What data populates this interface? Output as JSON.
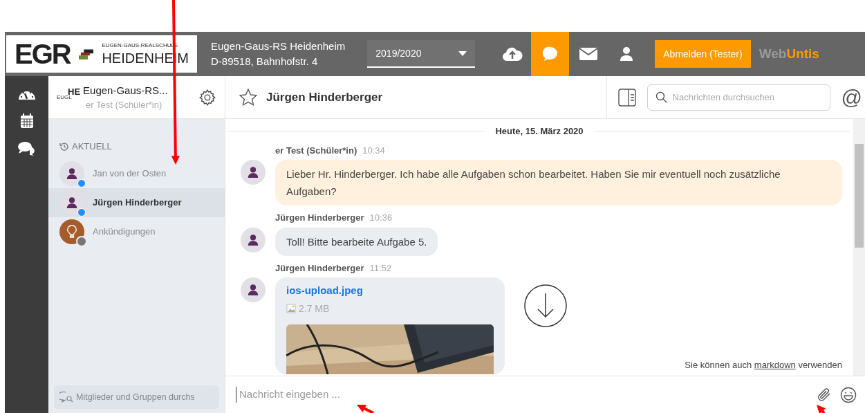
{
  "header": {
    "logo": {
      "letters": "EGR",
      "school_small": "EUGEN-GAUS-REALSCHULE",
      "school_big": "HEIDENHEIM"
    },
    "address": [
      "Eugen-Gaus-RS Heidenheim",
      "D-89518, Bahnhofstr. 4"
    ],
    "year": "2019/2020",
    "icons": [
      {
        "kind": "upload",
        "selected": false
      },
      {
        "kind": "chat",
        "selected": true
      },
      {
        "kind": "mail",
        "selected": false
      },
      {
        "kind": "user",
        "selected": false
      }
    ],
    "logout": "Abmelden (Tester)",
    "brand": [
      "Web",
      "Untis"
    ]
  },
  "rail": [
    {
      "kind": "dashboard"
    },
    {
      "kind": "calendar"
    },
    {
      "kind": "messages"
    }
  ],
  "sidebar": {
    "account": {
      "logo_small": "EUGL",
      "logo_big": "HE",
      "name": "Eugen-Gaus-RS...",
      "role": "er Test (Schüler*in)"
    },
    "section": "AKTUELL",
    "items": [
      {
        "name": "Jan von der Osten",
        "kind": "person",
        "selected": false,
        "online": true
      },
      {
        "name": "Jürgen Hinderberger",
        "kind": "person",
        "selected": true,
        "online": true
      },
      {
        "name": "Ankündigungen",
        "kind": "announcement",
        "selected": false,
        "online": false
      }
    ],
    "search_placeholder": "Mitglieder und Gruppen durchs"
  },
  "chat": {
    "title": "Jürgen Hinderberger",
    "search_placeholder": "Nachrichten durchsuchen",
    "date": "Heute, 15. März 2020",
    "messages": [
      {
        "author": "er Test (Schüler*in)",
        "time": "10:34",
        "kind": "own",
        "text": "Lieber Hr. Hinderberger. Ich habe alle Aufgaben schon bearbeitet. Haben Sie mir eventuell noch zusätzliche Aufgaben?"
      },
      {
        "author": "Jürgen Hinderberger",
        "time": "10:36",
        "kind": "other",
        "text": "Toll! Bitte bearbeite Aufgabe 5."
      },
      {
        "author": "Jürgen Hinderberger",
        "time": "11:52",
        "kind": "file",
        "file": "ios-upload.jpeg",
        "size": "2.7 MB"
      }
    ],
    "mention": "@",
    "hint": [
      "Sie können auch ",
      "markdown",
      " verwenden"
    ],
    "input_placeholder": "Nachricht eingeben ..."
  }
}
